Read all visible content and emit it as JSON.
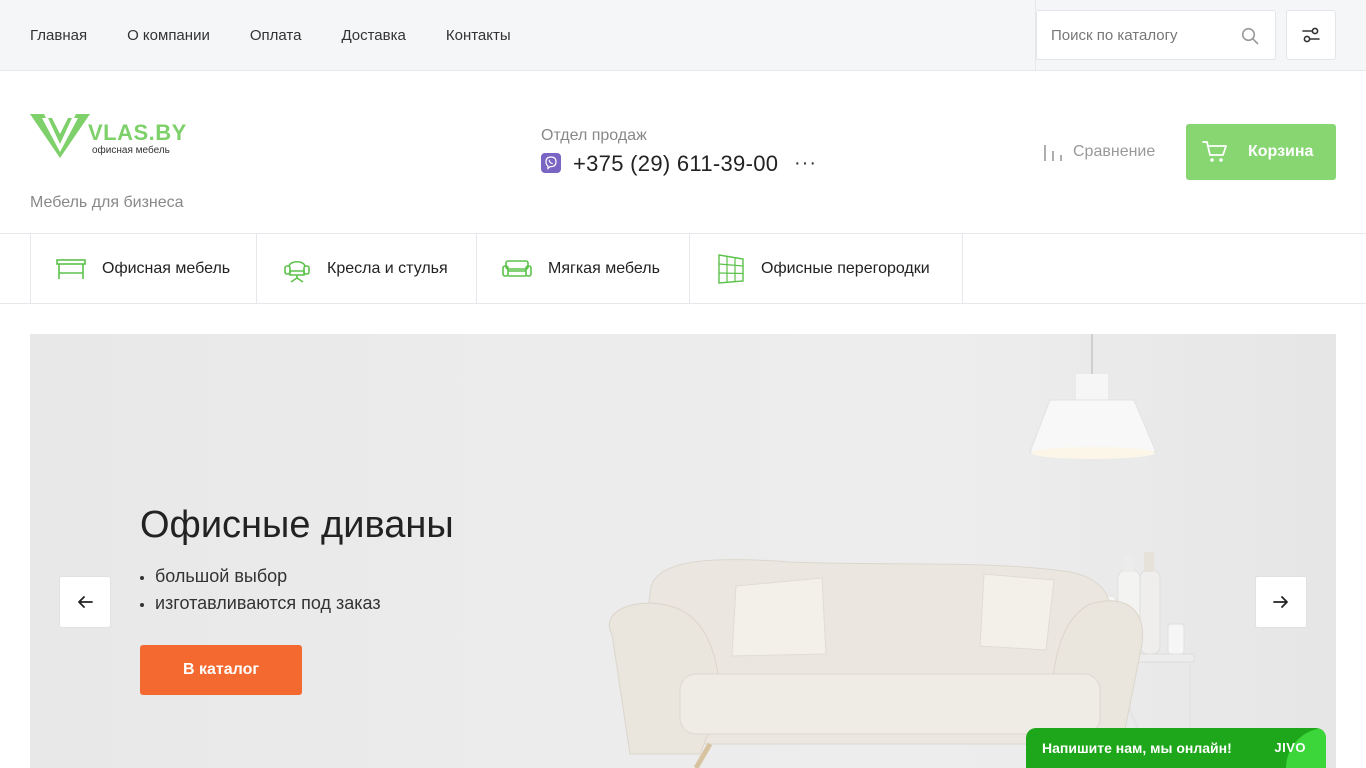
{
  "topnav": {
    "items": [
      {
        "label": "Главная"
      },
      {
        "label": "О компании"
      },
      {
        "label": "Оплата"
      },
      {
        "label": "Доставка"
      },
      {
        "label": "Контакты"
      }
    ]
  },
  "search": {
    "placeholder": "Поиск по каталогу",
    "value": ""
  },
  "header": {
    "logo_text": "VLAS.BY",
    "logo_subtitle": "офисная мебель",
    "tagline": "Мебель для бизнеса",
    "sales_label": "Отдел продаж",
    "phone": "+375 (29) 611-39-00",
    "more": "···",
    "compare_label": "Сравнение",
    "cart_label": "Корзина"
  },
  "categories": [
    {
      "label": "Офисная мебель",
      "icon": "desk-icon"
    },
    {
      "label": "Кресла и стулья",
      "icon": "armchair-icon"
    },
    {
      "label": "Мягкая мебель",
      "icon": "sofa-icon"
    },
    {
      "label": "Офисные перегородки",
      "icon": "partition-icon"
    }
  ],
  "hero": {
    "title": "Офисные диваны",
    "bullets": [
      "большой выбор",
      "изготавливаются под заказ"
    ],
    "button_label": "В каталог",
    "prev_label": "←",
    "next_label": "→"
  },
  "chat": {
    "text": "Напишите нам, мы онлайн!",
    "brand": "JIVO"
  },
  "colors": {
    "brand_green": "#87d672",
    "logo_green": "#7ed06a",
    "cta_orange": "#f4692f",
    "chat_green": "#1ea71a",
    "viber_purple": "#7b65c4"
  }
}
